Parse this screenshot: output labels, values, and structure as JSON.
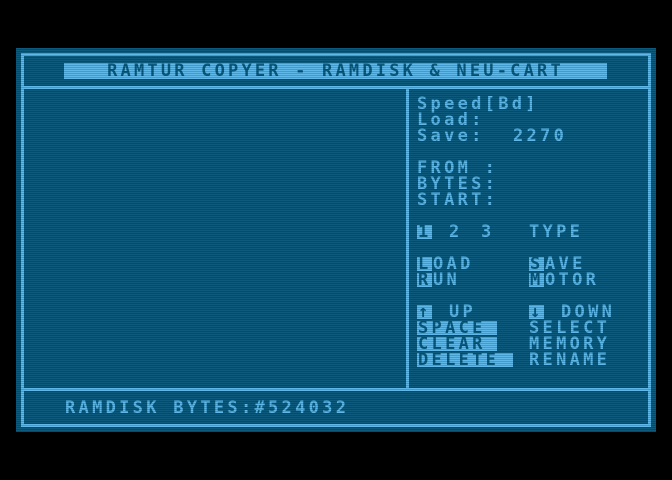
{
  "title": "RAMTUR COPYER - RAMDISK & NEU-CART",
  "info": {
    "speed_label": "Speed[Bd]",
    "load_label": "Load:",
    "save_label": "Save:",
    "save_value": "2270",
    "from_label": "FROM :",
    "bytes_label": "BYTES:",
    "start_label": "START:"
  },
  "type_row": {
    "key1": "1",
    "key2": "2",
    "key3": "3",
    "label": "TYPE"
  },
  "commands": {
    "load_key": "L",
    "load_rest": "OAD",
    "save_key": "S",
    "save_rest": "AVE",
    "run_key": "R",
    "run_rest": "UN",
    "motor_key": "M",
    "motor_rest": "OTOR"
  },
  "nav": {
    "up_icon": "↑",
    "up_label": "UP",
    "down_icon": "↓",
    "down_label": "DOWN",
    "space_key": "SPACE",
    "space_label": "SELECT",
    "clear_key": "CLEAR",
    "clear_label": "MEMORY",
    "delete_key": "DELETE",
    "delete_label": "RENAME"
  },
  "status": {
    "text": "RAMDISK BYTES:#524032"
  },
  "colors": {
    "background": "#0d5a7c",
    "foreground": "#5fb8e8",
    "border": "#000000"
  }
}
